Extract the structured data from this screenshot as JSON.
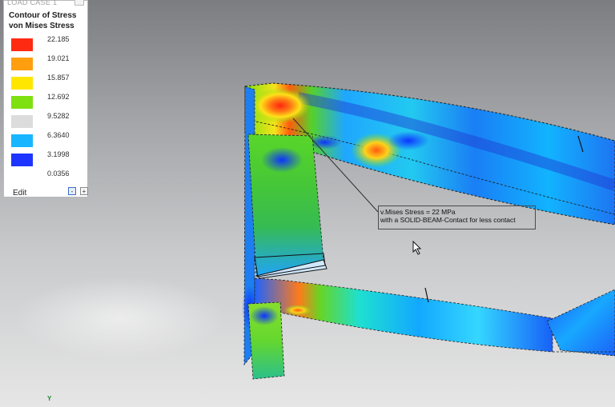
{
  "legend": {
    "header": "LOAD CASE 1",
    "title_line1": "Contour of Stress",
    "title_line2": "von Mises Stress",
    "items": [
      {
        "value": "22.185",
        "color": "#ff2a12"
      },
      {
        "value": "19.021",
        "color": "#ff9e0f"
      },
      {
        "value": "15.857",
        "color": "#ffe600"
      },
      {
        "value": "12.692",
        "color": "#7ee010"
      },
      {
        "value": "9.5282",
        "color": "#dcdcdc"
      },
      {
        "value": "6.3640",
        "color": "#19b6ff"
      },
      {
        "value": "3.1998",
        "color": "#1d35ff"
      },
      {
        "value": "0.0356",
        "color": ""
      }
    ],
    "edit_label": "Edit",
    "minus_label": "-",
    "plus_label": "+"
  },
  "annotation": {
    "line1": "v.Mises Stress = 22 MPa",
    "line2": "with a SOLID-BEAM-Contact for less contact"
  },
  "axis": {
    "y_label": "Y"
  },
  "icons": {
    "cursor": "mouse-pointer-icon"
  }
}
